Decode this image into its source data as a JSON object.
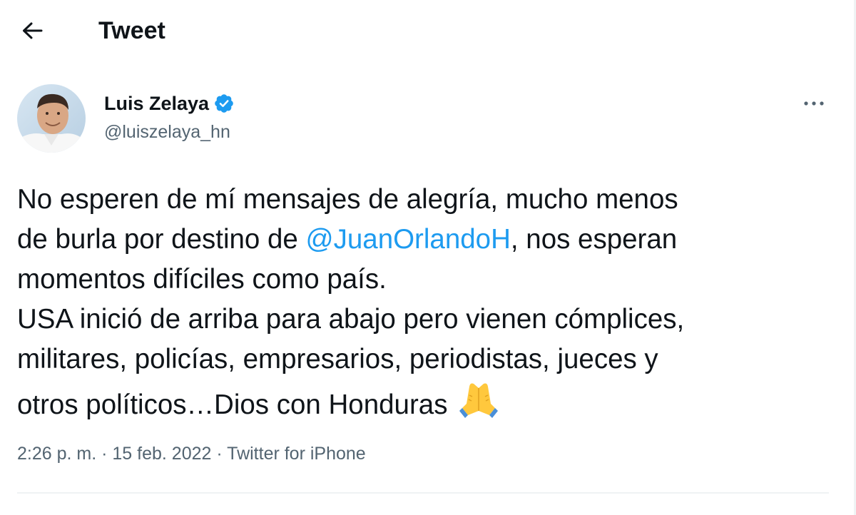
{
  "header": {
    "title": "Tweet"
  },
  "author": {
    "display_name": "Luis Zelaya",
    "handle": "@luiszelaya_hn",
    "verified": true
  },
  "tweet": {
    "line1": "No esperen de mí mensajes de alegría, mucho menos",
    "line2_pre": "de burla por destino de ",
    "line2_mention": "@JuanOrlandoH",
    "line2_post": ", nos esperan",
    "line3": "momentos difíciles como país.",
    "line4": "USA inició de arriba para abajo pero vienen cómplices,",
    "line5": "militares, policías, empresarios, periodistas, jueces y",
    "line6": "otros políticos…Dios con Honduras",
    "emoji": "folded-hands"
  },
  "meta": {
    "time": "2:26 p. m.",
    "sep1": " · ",
    "date": "15 feb. 2022",
    "sep2": " · ",
    "source": "Twitter for iPhone"
  },
  "colors": {
    "accent": "#1d9bf0",
    "text": "#0f1419",
    "secondary": "#536471",
    "divider": "#eff3f4"
  }
}
